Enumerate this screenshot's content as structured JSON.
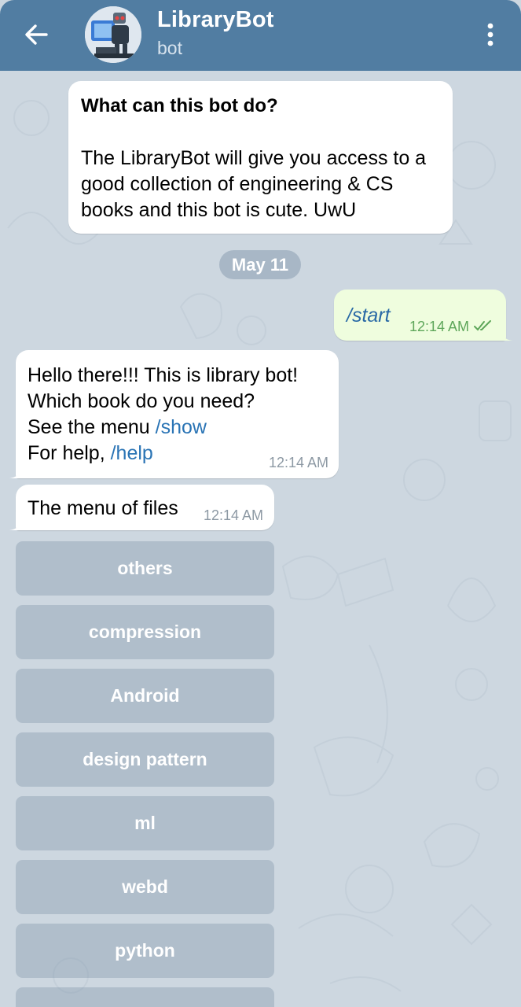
{
  "header": {
    "title": "LibraryBot",
    "subtitle": "bot",
    "bg_color": "#517da2"
  },
  "intro": {
    "heading": "What can this bot do?",
    "body": "The LibraryBot will give you access to a good collection of engineering & CS books and this bot is cute. UwU"
  },
  "date_separator": "May 11",
  "messages": {
    "outgoing": {
      "text": "/start",
      "time": "12:14 AM",
      "status": "read"
    },
    "bot_greeting": {
      "line1": "Hello there!!! This is library bot!",
      "line2": "Which book do you need?",
      "line3_prefix": "See the menu ",
      "line3_cmd": "/show",
      "line4_prefix": "For help, ",
      "line4_cmd": "/help",
      "time": "12:14 AM"
    },
    "bot_menu": {
      "text": "The menu of files",
      "time": "12:14 AM"
    }
  },
  "keyboard": [
    "others",
    "compression",
    "Android",
    "design pattern",
    "ml",
    "webd",
    "python"
  ],
  "icons": {
    "back": "arrow-left-icon",
    "more": "vertical-dots-icon",
    "read_status": "double-check-icon"
  }
}
